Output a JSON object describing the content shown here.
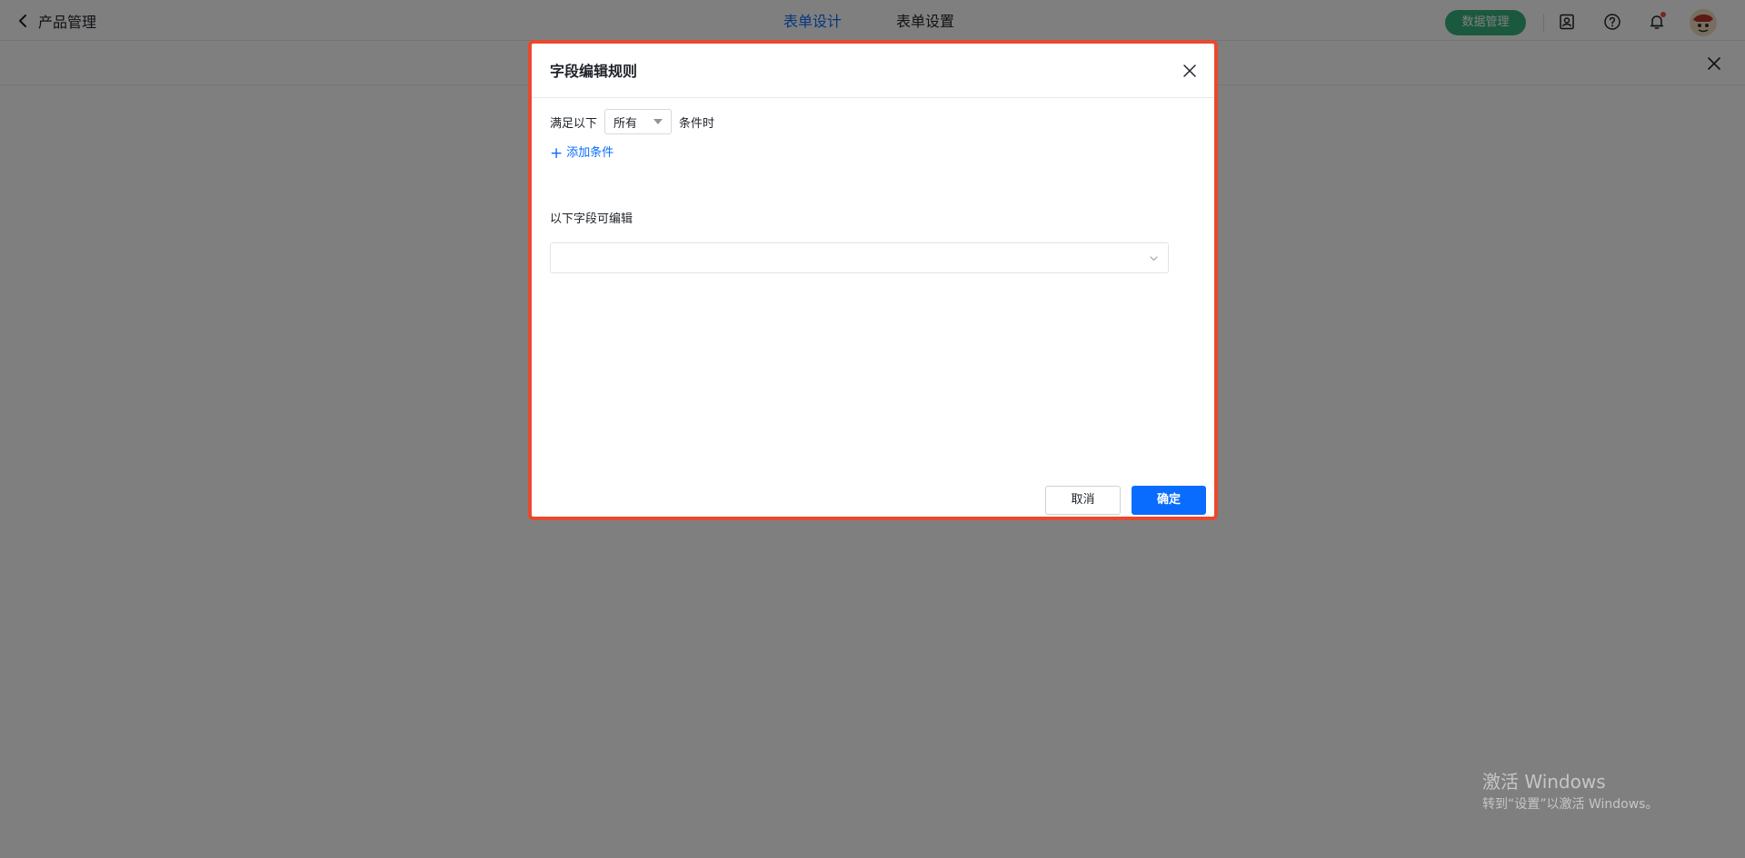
{
  "header": {
    "back_label": "产品管理",
    "tabs": [
      {
        "label": "表单设计",
        "active": true
      },
      {
        "label": "表单设置",
        "active": false
      }
    ],
    "data_button_label": "数据管理",
    "icons": [
      "contact-icon",
      "help-icon",
      "bell-icon"
    ],
    "accent_color": "#0a6cff",
    "data_button_color": "#36b37e"
  },
  "modal": {
    "title": "字段编辑规则",
    "condition": {
      "prefix": "满足以下",
      "selected": "所有",
      "suffix": "条件时"
    },
    "add_condition_label": "添加条件",
    "editable_fields_label": "以下字段可编辑",
    "editable_fields_value": "",
    "cancel_label": "取消",
    "ok_label": "确定",
    "highlight_color": "#e8492f"
  },
  "watermark": {
    "title": "激活 Windows",
    "subtitle": "转到“设置”以激活 Windows。"
  }
}
